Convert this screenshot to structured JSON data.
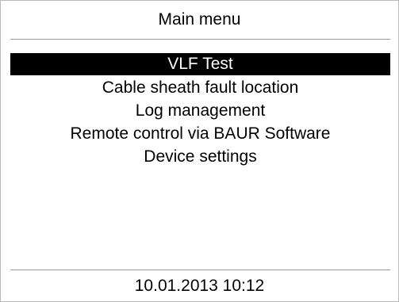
{
  "header": {
    "title": "Main menu"
  },
  "menu": {
    "items": [
      {
        "label": "VLF Test"
      },
      {
        "label": "Cable sheath fault location"
      },
      {
        "label": "Log management"
      },
      {
        "label": "Remote control via BAUR Software"
      },
      {
        "label": "Device settings"
      }
    ]
  },
  "footer": {
    "datetime": "10.01.2013 10:12"
  },
  "colors": {
    "selection_background": "#000000",
    "selection_text": "#ffffff",
    "divider": "#999999"
  }
}
